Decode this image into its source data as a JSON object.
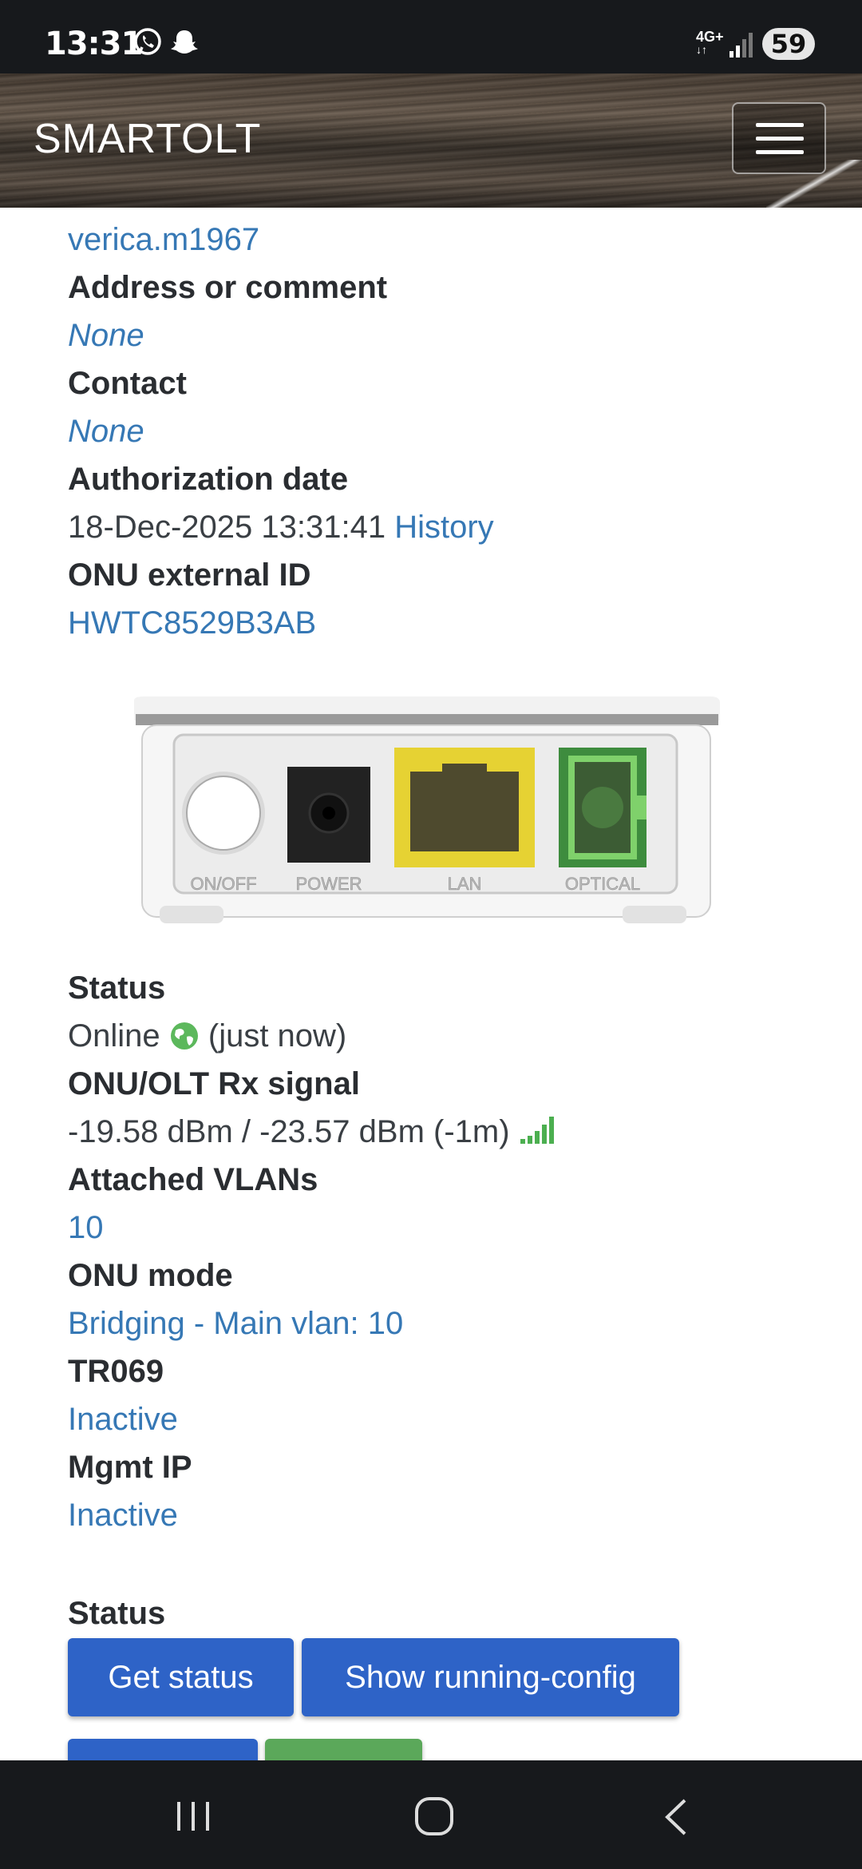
{
  "status_bar": {
    "time": "13:31",
    "network": "4G+",
    "battery": "59"
  },
  "navbar": {
    "brand": "SMARTOLT"
  },
  "details": {
    "username": "verica.m1967",
    "address_label": "Address or comment",
    "address_value": "None",
    "contact_label": "Contact",
    "contact_value": "None",
    "auth_date_label": "Authorization date",
    "auth_date_value": "18-Dec-2025 13:31:41",
    "auth_history_link": "History",
    "external_id_label": "ONU external ID",
    "external_id_value": "HWTC8529B3AB"
  },
  "device_ports": [
    "ON/OFF",
    "POWER",
    "LAN",
    "OPTICAL"
  ],
  "status_section": {
    "status_label": "Status",
    "status_value": "Online",
    "status_time": "(just now)",
    "rx_label": "ONU/OLT Rx signal",
    "rx_value": "-19.58 dBm / -23.57 dBm (-1m)",
    "vlans_label": "Attached VLANs",
    "vlans_value": "10",
    "mode_label": "ONU mode",
    "mode_value": "Bridging - Main vlan: 10",
    "tr069_label": "TR069",
    "tr069_value": "Inactive",
    "mgmt_label": "Mgmt IP",
    "mgmt_value": "Inactive"
  },
  "actions": {
    "heading": "Status",
    "get_status": "Get status",
    "show_config": "Show running-config"
  },
  "colors": {
    "link": "#3678b5",
    "primary_button": "#2e63c7",
    "success_button": "#5ba85a",
    "signal": "#4caf50"
  }
}
